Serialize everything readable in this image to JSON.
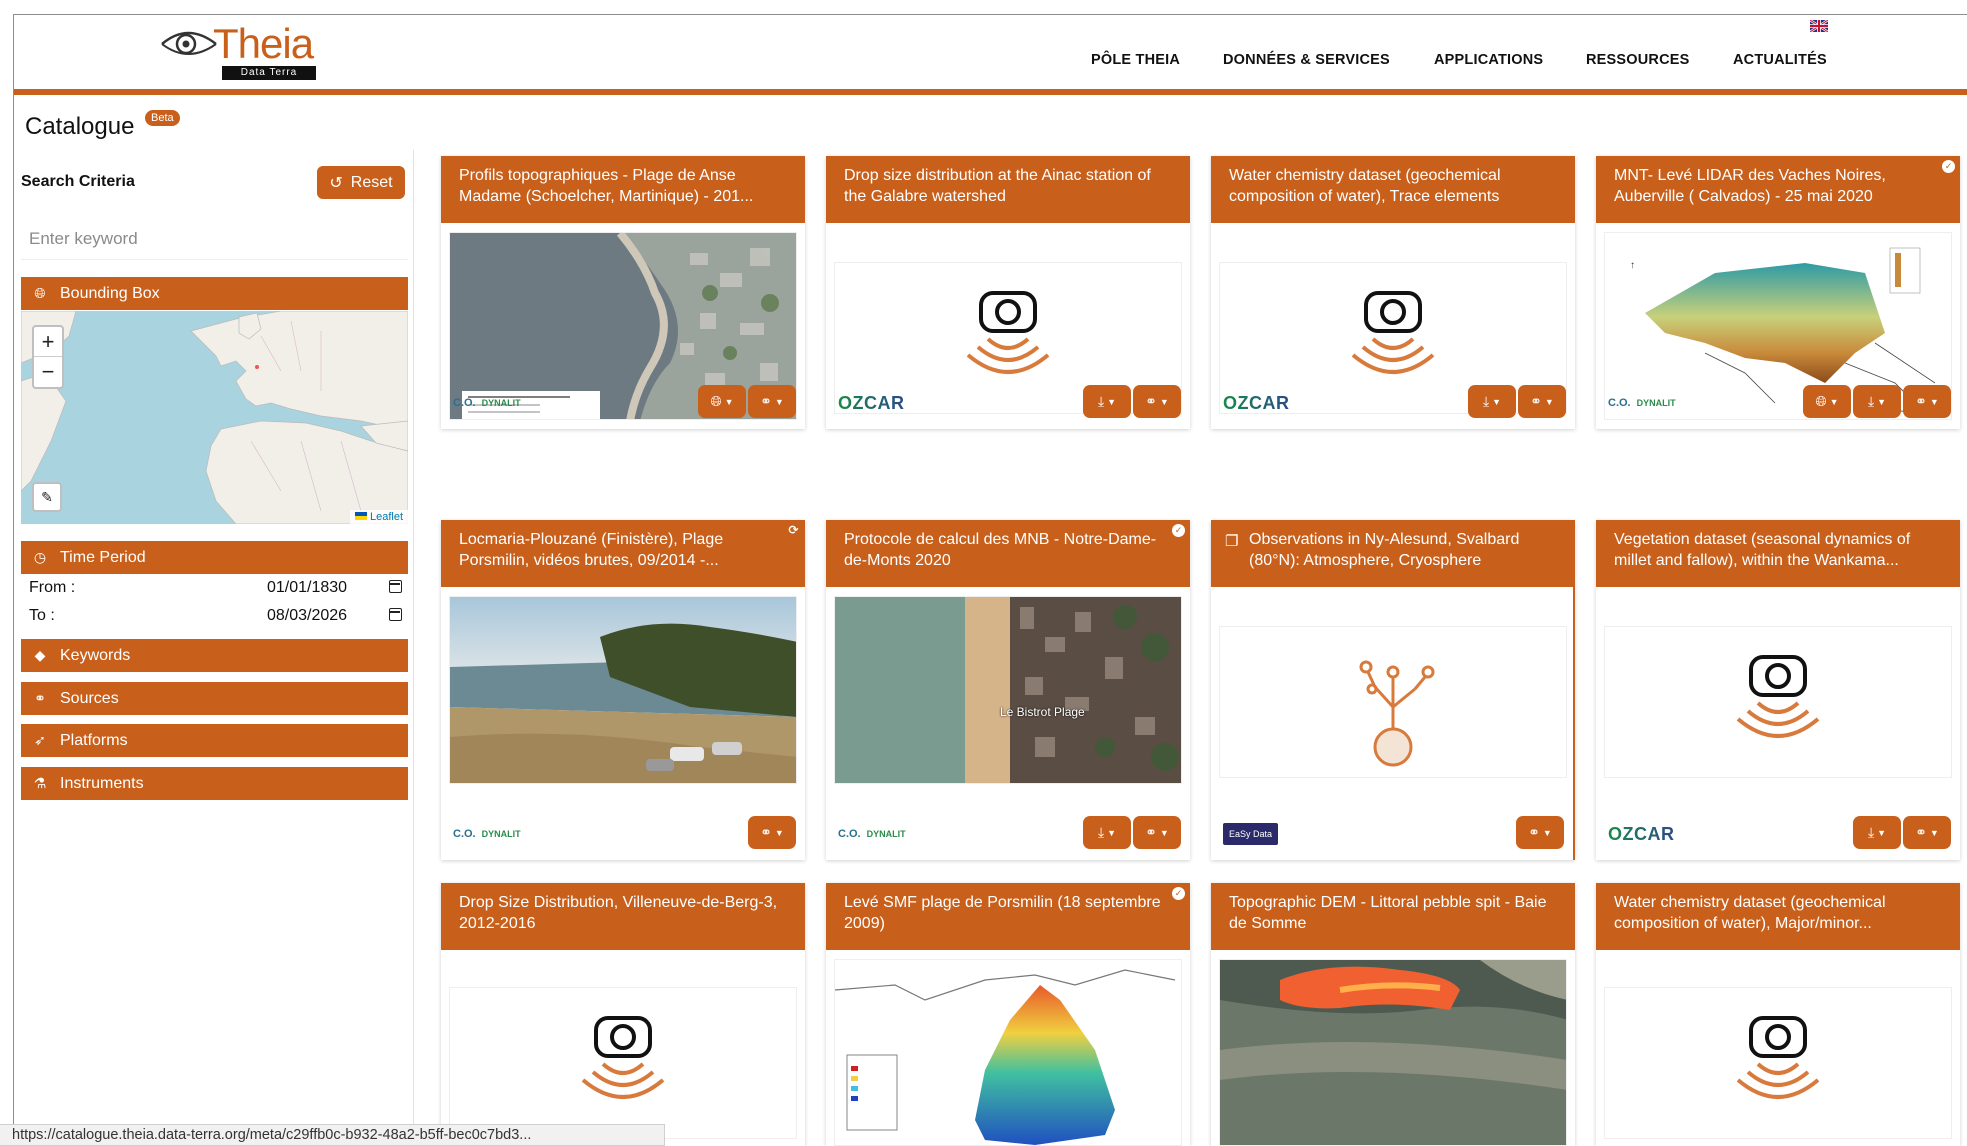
{
  "header": {
    "logo_text": "Theia",
    "logo_sub": "Data Terra",
    "nav": [
      "PÔLE THEIA",
      "DONNÉES & SERVICES",
      "APPLICATIONS",
      "RESSOURCES",
      "ACTUALITÉS"
    ],
    "language_flag": "uk-flag-icon"
  },
  "page": {
    "title": "Catalogue",
    "badge": "Beta"
  },
  "sidebar": {
    "search_criteria_label": "Search Criteria",
    "reset_label": "Reset",
    "keyword_placeholder": "Enter keyword",
    "bounding_box_label": "Bounding Box",
    "map": {
      "zoom_in": "+",
      "zoom_out": "−",
      "attribution": "Leaflet"
    },
    "time_period_label": "Time Period",
    "from_label": "From :",
    "from_value": "01/01/1830",
    "to_label": "To :",
    "to_value": "08/03/2026",
    "sections": [
      "Keywords",
      "Sources",
      "Platforms",
      "Instruments"
    ]
  },
  "cards": [
    {
      "title": "Profils topographiques - Plage de Anse Madame (Schoelcher, Martinique) - 201...",
      "image": "aerial-beach",
      "logo": "co-dynalit",
      "buttons": [
        "globe",
        "link"
      ]
    },
    {
      "title": "Drop size distribution at the Ainac station of the Galabre watershed",
      "image": "sensor-icon",
      "logo": "ozcar",
      "buttons": [
        "download",
        "link"
      ]
    },
    {
      "title": "Water chemistry dataset (geochemical composition of water), Trace elements",
      "image": "sensor-icon",
      "logo": "ozcar",
      "buttons": [
        "download",
        "link"
      ]
    },
    {
      "title": "MNT- Levé LIDAR des Vaches Noires, Auberville ( Calvados) - 25 mai 2020",
      "image": "lidar-map",
      "logo": "co-dynalit",
      "buttons": [
        "globe",
        "download",
        "link"
      ]
    },
    {
      "title": "Locmaria-Plouzané (Finistère), Plage Porsmilin, vidéos brutes, 09/2014 -...",
      "image": "beach-photo",
      "logo": "co-dynalit",
      "buttons": [
        "link"
      ]
    },
    {
      "title": "Protocole de calcul des MNB - Notre-Dame-de-Monts 2020",
      "image": "aerial-coast",
      "image_label": "Le Bistrot Plage",
      "logo": "co-dynalit",
      "buttons": [
        "download",
        "link"
      ]
    },
    {
      "title": "Observations in Ny-Alesund, Svalbard (80°N): Atmosphere, Cryosphere",
      "image": "tree-icon",
      "logo": "easy-data",
      "logo_text": "EaSy Data",
      "buttons": [
        "link"
      ]
    },
    {
      "title": "Vegetation dataset (seasonal dynamics of millet and fallow), within the Wankama...",
      "image": "sensor-icon",
      "logo": "ozcar",
      "buttons": [
        "download",
        "link"
      ]
    },
    {
      "title": "Drop Size Distribution, Villeneuve-de-Berg-3, 2012-2016",
      "image": "sensor-icon",
      "logo": "",
      "buttons": []
    },
    {
      "title": "Levé SMF plage de Porsmilin (18 septembre 2009)",
      "image": "bathymetry",
      "logo": "",
      "buttons": []
    },
    {
      "title": "Topographic DEM - Littoral pebble spit - Baie de Somme",
      "image": "dem-aerial",
      "logo": "",
      "buttons": []
    },
    {
      "title": "Water chemistry dataset (geochemical composition of water), Major/minor...",
      "image": "sensor-icon",
      "logo": "",
      "buttons": []
    }
  ],
  "logos": {
    "ozcar": "OZCAR",
    "dynalit": "DYNALIT",
    "co": "C.O."
  },
  "status_url": "https://catalogue.theia.data-terra.org/meta/c29ffb0c-b932-48a2-b5ff-bec0c7bd3...",
  "colors": {
    "accent": "#c8601c",
    "map_water": "#a9d3df"
  }
}
